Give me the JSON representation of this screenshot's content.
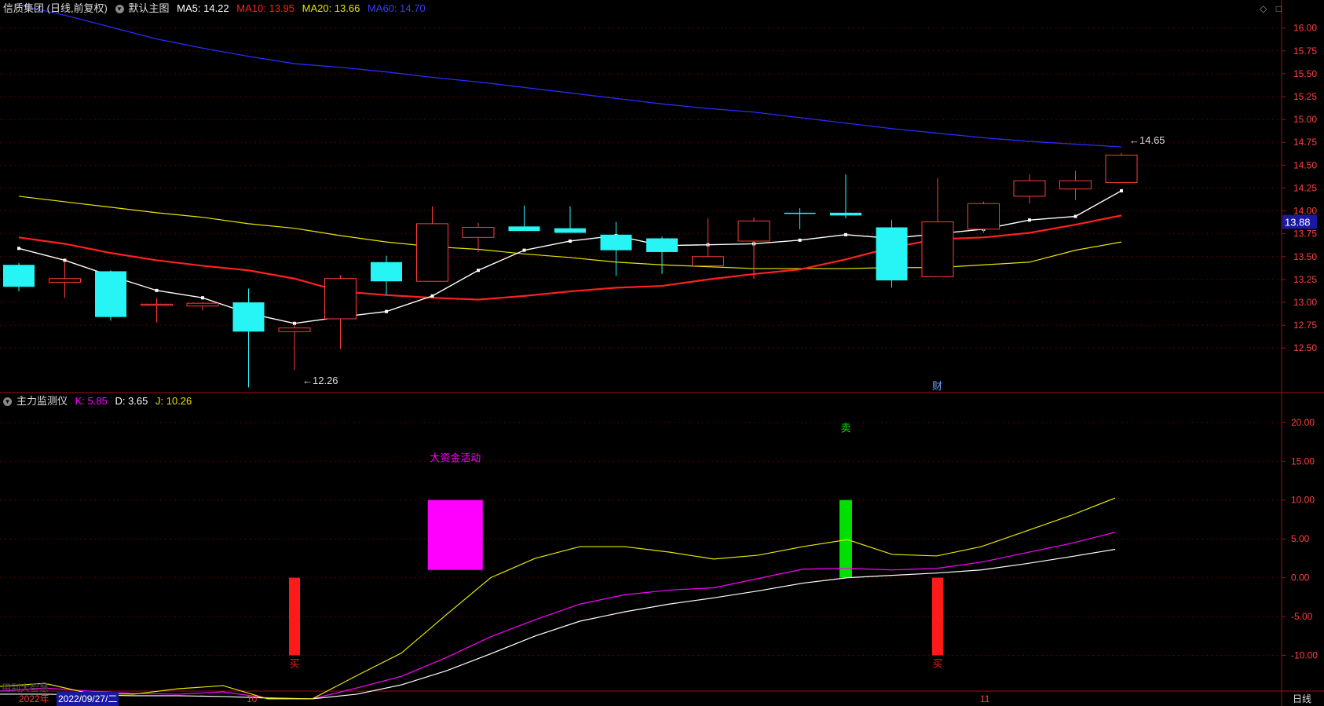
{
  "header": {
    "stock_title": "信质集团 (日线,前复权)",
    "main_chart_label": "默认主图",
    "ma5_label": "MA5: 14.22",
    "ma10_label": "MA10: 13.95",
    "ma20_label": "MA20: 13.66",
    "ma60_label": "MA60: 14.70"
  },
  "indicator_header": {
    "name": "主力监测仪",
    "k_label": "K: 5.85",
    "d_label": "D: 3.65",
    "j_label": "J: 10.26"
  },
  "bottom_bar": {
    "year_label": "2022年",
    "date_label": "2022/09/27/二",
    "month_10": "10",
    "month_11": "11",
    "period_label": "日线",
    "overlay_text": "用到大智慧"
  },
  "colors": {
    "up": "#ff3b3b",
    "down": "#27f5f5",
    "ma5": "#ffffff",
    "ma10": "#ff2020",
    "ma20": "#e6e600",
    "ma60": "#2a2aff",
    "k": "#ff00ff",
    "d": "#ffffff",
    "j": "#e6e600",
    "axis": "#a01010",
    "grid": "#5a0000"
  },
  "chart_data": [
    {
      "type": "candlestick",
      "title": "信质集团 (日线,前复权)",
      "ylim": [
        12.15,
        16.1
      ],
      "y_ticks": [
        "16.00",
        "15.75",
        "15.50",
        "15.25",
        "15.00",
        "14.75",
        "14.50",
        "14.25",
        "14.00",
        "13.75",
        "13.50",
        "13.25",
        "13.00",
        "12.75",
        "12.50"
      ],
      "candles": [
        {
          "o": 13.41,
          "h": 13.43,
          "l": 13.12,
          "c": 13.17
        },
        {
          "o": 13.22,
          "h": 13.45,
          "l": 13.05,
          "c": 13.26
        },
        {
          "o": 13.34,
          "h": 13.35,
          "l": 12.8,
          "c": 12.84
        },
        {
          "o": 12.98,
          "h": 13.05,
          "l": 12.78,
          "c": 12.98
        },
        {
          "o": 12.96,
          "h": 13.0,
          "l": 12.91,
          "c": 12.99
        },
        {
          "o": 13.0,
          "h": 13.15,
          "l": 12.07,
          "c": 12.68
        },
        {
          "o": 12.68,
          "h": 12.76,
          "l": 12.26,
          "c": 12.72
        },
        {
          "o": 12.82,
          "h": 13.3,
          "l": 12.49,
          "c": 13.26
        },
        {
          "o": 13.44,
          "h": 13.51,
          "l": 13.08,
          "c": 13.23
        },
        {
          "o": 13.23,
          "h": 14.05,
          "l": 13.23,
          "c": 13.86
        },
        {
          "o": 13.71,
          "h": 13.87,
          "l": 13.55,
          "c": 13.82
        },
        {
          "o": 13.83,
          "h": 14.06,
          "l": 13.78,
          "c": 13.78
        },
        {
          "o": 13.81,
          "h": 14.05,
          "l": 13.78,
          "c": 13.76
        },
        {
          "o": 13.74,
          "h": 13.88,
          "l": 13.29,
          "c": 13.57
        },
        {
          "o": 13.7,
          "h": 13.72,
          "l": 13.31,
          "c": 13.55
        },
        {
          "o": 13.4,
          "h": 13.92,
          "l": 13.38,
          "c": 13.5
        },
        {
          "o": 13.67,
          "h": 13.93,
          "l": 13.26,
          "c": 13.89
        },
        {
          "o": 13.98,
          "h": 14.03,
          "l": 13.8,
          "c": 13.97
        },
        {
          "o": 13.98,
          "h": 14.4,
          "l": 13.92,
          "c": 13.95
        },
        {
          "o": 13.82,
          "h": 13.9,
          "l": 13.16,
          "c": 13.24
        },
        {
          "o": 13.28,
          "h": 14.36,
          "l": 13.28,
          "c": 13.88
        },
        {
          "o": 13.8,
          "h": 14.1,
          "l": 13.76,
          "c": 14.08
        },
        {
          "o": 14.16,
          "h": 14.4,
          "l": 14.08,
          "c": 14.33
        },
        {
          "o": 14.24,
          "h": 14.44,
          "l": 14.12,
          "c": 14.33
        },
        {
          "o": 14.31,
          "h": 14.63,
          "l": 14.31,
          "c": 14.61
        }
      ],
      "series": [
        {
          "name": "MA5",
          "values": [
            13.59,
            13.46,
            13.29,
            13.13,
            13.05,
            12.88,
            12.77,
            12.84,
            12.9,
            13.07,
            13.35,
            13.57,
            13.67,
            13.73,
            13.62,
            13.63,
            13.64,
            13.68,
            13.74,
            13.7,
            13.75,
            13.8,
            13.9,
            13.94,
            14.22
          ]
        },
        {
          "name": "MA10",
          "values": [
            13.71,
            13.64,
            13.54,
            13.46,
            13.4,
            13.35,
            13.26,
            13.12,
            13.08,
            13.05,
            13.03,
            13.07,
            13.12,
            13.16,
            13.18,
            13.25,
            13.31,
            13.36,
            13.47,
            13.6,
            13.69,
            13.71,
            13.76,
            13.85,
            13.95
          ]
        },
        {
          "name": "MA20",
          "values": [
            14.16,
            14.1,
            14.04,
            13.98,
            13.93,
            13.86,
            13.81,
            13.73,
            13.66,
            13.61,
            13.58,
            13.53,
            13.49,
            13.44,
            13.41,
            13.39,
            13.37,
            13.37,
            13.37,
            13.38,
            13.38,
            13.41,
            13.44,
            13.57,
            13.66
          ]
        },
        {
          "name": "MA60",
          "values": [
            16.25,
            16.14,
            16.01,
            15.88,
            15.78,
            15.69,
            15.61,
            15.57,
            15.52,
            15.46,
            15.41,
            15.35,
            15.29,
            15.23,
            15.17,
            15.12,
            15.08,
            15.02,
            14.96,
            14.9,
            14.85,
            14.8,
            14.76,
            14.73,
            14.7
          ]
        }
      ],
      "annotations": [
        {
          "text": "←12.26",
          "index": 6,
          "value": 12.26
        },
        {
          "text": "←14.65",
          "index": 24,
          "value": 14.65
        },
        {
          "text": "财",
          "index": 20,
          "value": 12.18
        }
      ],
      "last_price_tag": "13.88"
    },
    {
      "type": "line",
      "title": "主力监测仪",
      "ylim": [
        -14.6,
        21.6
      ],
      "y_ticks": [
        "20.00",
        "15.00",
        "10.00",
        "5.00",
        "0.00",
        "-5.00",
        "-10.00"
      ],
      "series": [
        {
          "name": "K",
          "values": [
            -14.6,
            -14.2,
            -14.6,
            -14.9,
            -15.0,
            -14.7,
            -15.5,
            -15.6,
            -14.2,
            -12.7,
            -10.3,
            -7.6,
            -5.4,
            -3.4,
            -2.2,
            -1.6,
            -1.3,
            -0.1,
            1.1,
            1.2,
            1.0,
            1.2,
            2.0,
            3.2,
            4.4,
            5.85
          ]
        },
        {
          "name": "D",
          "values": [
            -15.0,
            -15.0,
            -15.1,
            -15.2,
            -15.2,
            -15.3,
            -15.5,
            -15.6,
            -15.0,
            -13.8,
            -12.0,
            -9.8,
            -7.5,
            -5.6,
            -4.4,
            -3.4,
            -2.6,
            -1.7,
            -0.7,
            0.0,
            0.3,
            0.6,
            1.0,
            1.8,
            2.7,
            3.65
          ]
        },
        {
          "name": "J",
          "values": [
            -14.0,
            -13.6,
            -14.9,
            -15.0,
            -14.3,
            -13.9,
            -15.6,
            -15.6,
            -12.6,
            -9.7,
            -4.8,
            0.0,
            2.5,
            4.0,
            4.0,
            3.3,
            2.4,
            2.9,
            4.0,
            4.9,
            3.0,
            2.8,
            4.0,
            6.0,
            8.0,
            10.26
          ]
        }
      ],
      "bars": [
        {
          "index": 6,
          "from": 0,
          "to": -10,
          "color": "#ff1a1a",
          "label": "买"
        },
        {
          "index": 9.5,
          "from": 1,
          "to": 10,
          "color": "#ff00ff",
          "label": "大资金活动"
        },
        {
          "index": 18,
          "from": 0,
          "to": 10,
          "color": "#00e000",
          "label": "卖"
        },
        {
          "index": 20,
          "from": 0,
          "to": -10,
          "color": "#ff1a1a",
          "label": "买"
        }
      ]
    }
  ]
}
